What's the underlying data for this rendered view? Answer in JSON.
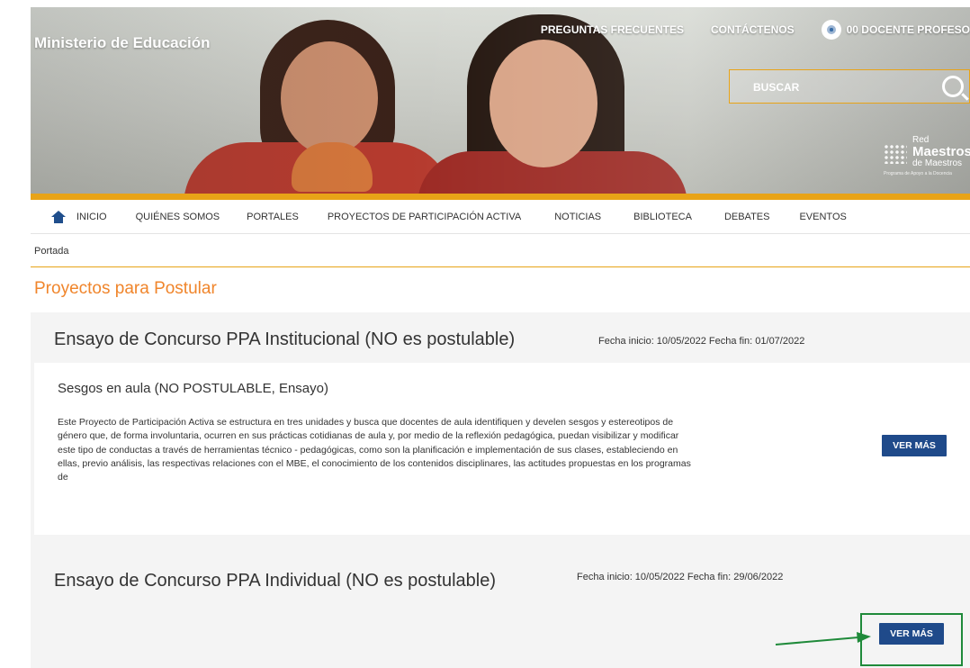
{
  "header": {
    "brand": "Ministerio de Educación",
    "faq_link": "PREGUNTAS FRECUENTES",
    "contact_link": "CONTÁCTENOS",
    "user_name": "00 DOCENTE PROFESO",
    "search_placeholder": "BUSCAR",
    "logo": {
      "line1": "Red",
      "line2": "Maestros",
      "line3": "de Maestros",
      "line4": "Programa de Apoyo a la Docencia"
    }
  },
  "nav": {
    "items": [
      "INICIO",
      "QUIÉNES SOMOS",
      "PORTALES",
      "PROYECTOS DE PARTICIPACIÓN ACTIVA",
      "NOTICIAS",
      "BIBLIOTECA",
      "DEBATES",
      "EVENTOS"
    ]
  },
  "breadcrumb": "Portada",
  "page_title": "Proyectos para Postular",
  "contests": [
    {
      "title": "Ensayo de Concurso PPA Institucional (NO es postulable)",
      "dates": "Fecha inicio: 10/05/2022 Fecha fin: 01/07/2022",
      "project": {
        "title": "Sesgos en aula (NO POSTULABLE, Ensayo)",
        "description": "Este Proyecto de Participación Activa se estructura en tres unidades y busca que docentes de aula identifiquen y develen sesgos y estereotipos de género que, de forma involuntaria, ocurren en sus prácticas cotidianas de aula y, por medio de la reflexión pedagógica, puedan visibilizar y modificar este tipo de conductas a través de herramientas técnico - pedagógicas, como son la planificación e implementación de sus clases, estableciendo en ellas, previo análisis, las respectivas relaciones con el MBE, el conocimiento de los contenidos disciplinares, las actitudes propuestas en los programas de",
        "button": "VER MÁS"
      }
    },
    {
      "title": "Ensayo de Concurso PPA Individual (NO es postulable)",
      "dates": "Fecha inicio: 10/05/2022 Fecha fin: 29/06/2022",
      "button": "VER MÁS"
    }
  ],
  "colors": {
    "accent_orange": "#e8a317",
    "title_orange": "#f0852b",
    "button_blue": "#1f4a8a",
    "highlight_green": "#1f8a3a"
  }
}
